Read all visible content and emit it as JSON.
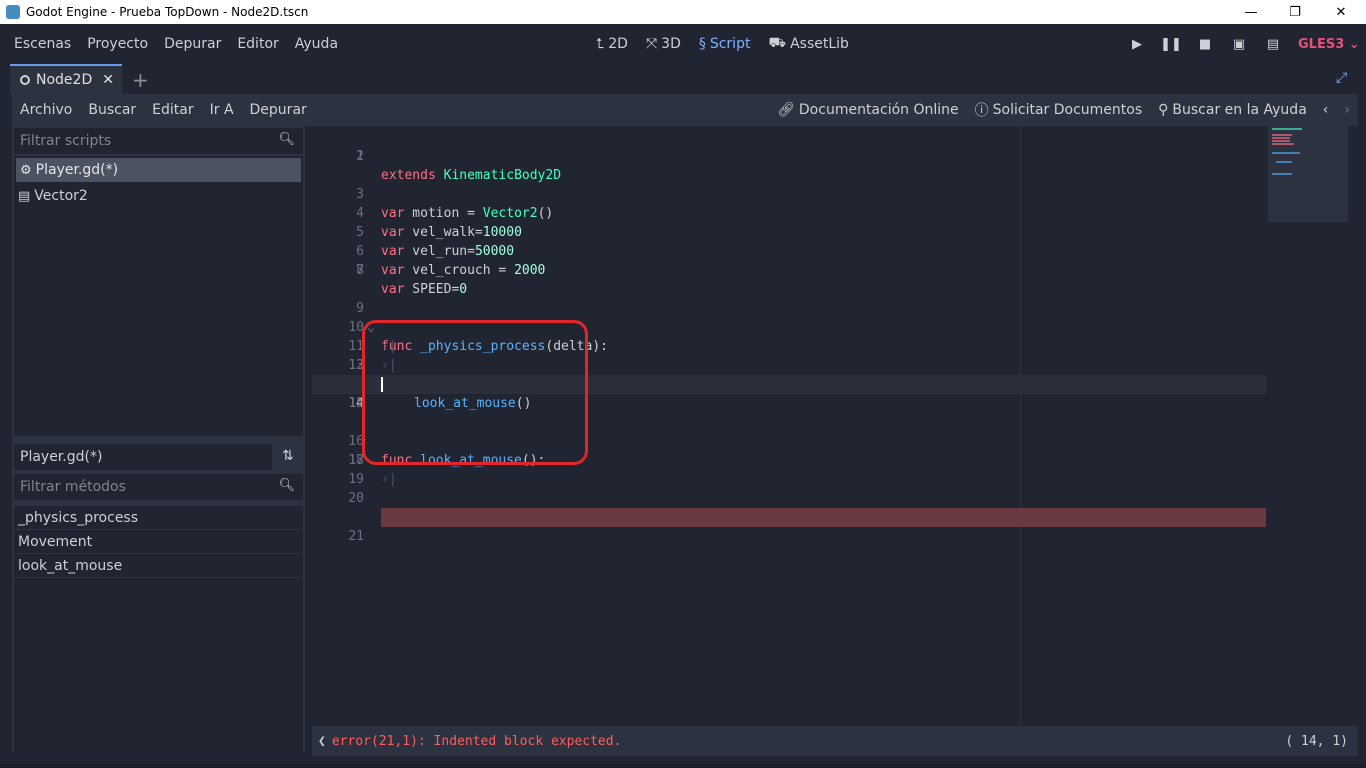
{
  "window": {
    "title": "Godot Engine - Prueba TopDown - Node2D.tscn",
    "minimize": "—",
    "maximize": "❐",
    "close": "✕"
  },
  "menu": [
    "Escenas",
    "Proyecto",
    "Depurar",
    "Editor",
    "Ayuda"
  ],
  "workspaces": {
    "tab_2d": "2D",
    "tab_3d": "3D",
    "tab_script": "Script",
    "tab_assetlib": "AssetLib"
  },
  "renderer": "GLES3",
  "scene_tab": {
    "label": "Node2D"
  },
  "script_menu": [
    "Archivo",
    "Buscar",
    "Editar",
    "Ir A",
    "Depurar"
  ],
  "help_links": {
    "online_docs": "Documentación Online",
    "request_docs": "Solicitar Documentos",
    "search_help": "Buscar en la Ayuda"
  },
  "scripts_panel": {
    "filter_placeholder": "Filtrar scripts",
    "items": [
      {
        "label": "Player.gd(*)",
        "icon": "gear-icon",
        "selected": true
      },
      {
        "label": "Vector2",
        "icon": "doc-icon",
        "selected": false
      }
    ]
  },
  "methods_panel": {
    "current_script": "Player.gd(*)",
    "filter_placeholder": "Filtrar métodos",
    "items": [
      "_physics_process",
      "Movement",
      "look_at_mouse"
    ]
  },
  "code": {
    "lines": [
      {
        "n": "1"
      },
      {
        "n": "2"
      },
      {
        "n": "3"
      },
      {
        "n": "4"
      },
      {
        "n": "5"
      },
      {
        "n": "6"
      },
      {
        "n": "7"
      },
      {
        "n": "8"
      },
      {
        "n": "9"
      },
      {
        "n": "10"
      },
      {
        "n": "11"
      },
      {
        "n": "12"
      },
      {
        "n": "13"
      },
      {
        "n": "14"
      },
      {
        "n": "15"
      },
      {
        "n": "16"
      },
      {
        "n": "17"
      },
      {
        "n": "18"
      },
      {
        "n": "19"
      },
      {
        "n": "20"
      },
      {
        "n": "21"
      }
    ],
    "kw_extends": "extends",
    "cls_kinematic": "KinematicBody2D",
    "kw_var": "var",
    "l3_rest": " motion = ",
    "cls_vector2": "Vector2",
    "l3_paren": "()",
    "l4_rest": " vel_walk=",
    "l4_num": "10000",
    "l5_rest": " vel_run=",
    "l5_num": "50000",
    "l6_rest": " vel_crouch = ",
    "l6_num": "2000",
    "l7_rest": " SPEED=",
    "l7_num": "0",
    "kw_func": "func",
    "l9_name": " _physics_process",
    "l9_rest": "(delta):",
    "l12_call": "look_at_mouse",
    "l12_paren": "()",
    "l16_name": " look_at_mouse",
    "l16_rest": "():",
    "tab_glyph": "›|",
    "fold_glyph": "⌄"
  },
  "status": {
    "error": "error(21,1): Indented block expected.",
    "position": "( 14,   1)",
    "toggle": "❮"
  },
  "colors": {
    "accent": "#699ce8",
    "error_line": "#6b3a40",
    "annotation": "#e3262a"
  }
}
